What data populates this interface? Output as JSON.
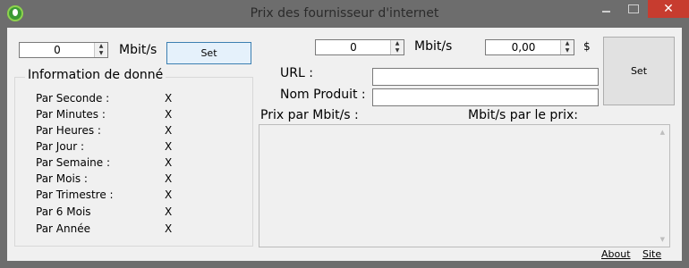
{
  "window": {
    "title": "Prix des fournisseur d'internet",
    "close": "✕"
  },
  "left": {
    "value": "0",
    "unit": "Mbit/s",
    "set_label": "Set",
    "group_title": "Information de donné",
    "rows": [
      {
        "label": "Par Seconde :",
        "value": "X"
      },
      {
        "label": "Par Minutes :",
        "value": "X"
      },
      {
        "label": "Par Heures :",
        "value": "X"
      },
      {
        "label": "Par Jour :",
        "value": "X"
      },
      {
        "label": "Par Semaine :",
        "value": "X"
      },
      {
        "label": "Par Mois :",
        "value": "X"
      },
      {
        "label": "Par Trimestre :",
        "value": "X"
      },
      {
        "label": "Par 6 Mois",
        "value": "X"
      },
      {
        "label": "Par Année",
        "value": "X"
      }
    ]
  },
  "right": {
    "speed_value": "0",
    "speed_unit": "Mbit/s",
    "price_value": "0,00",
    "currency": "$",
    "set_label": "Set",
    "url_label": "URL :",
    "product_label": "Nom Produit :",
    "price_per_label": "Prix par Mbit/s :",
    "mbit_per_price_label": "Mbit/s par le prix:"
  },
  "footer": {
    "about": "About",
    "site": "Site"
  }
}
